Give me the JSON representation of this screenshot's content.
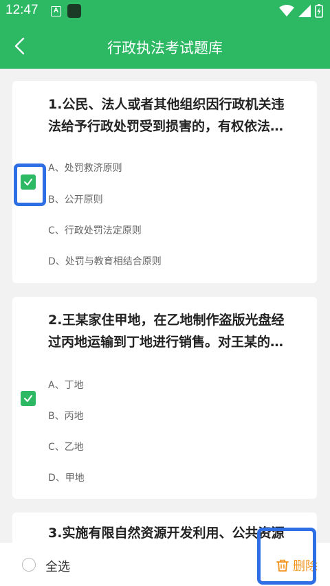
{
  "status_bar": {
    "time": "12:47",
    "notification_letter": "A"
  },
  "header": {
    "title": "行政执法考试题库"
  },
  "questions": [
    {
      "title_line1": "1.公民、法人或者其他组织因行政机关违",
      "title_line2": "法给予行政处罚受到损害的，有权依法…",
      "checked": true,
      "options": [
        "A、处罚救济原则",
        "B、公开原则",
        "C、行政处罚法定原则",
        "D、处罚与教育相结合原则"
      ]
    },
    {
      "title_line1": "2.王某家住甲地，在乙地制作盗版光盘经",
      "title_line2": "过丙地运输到丁地进行销售。对王某的…",
      "checked": true,
      "options": [
        "A、丁地",
        "B、丙地",
        "C、乙地",
        "D、甲地"
      ]
    },
    {
      "title_line1": "3.实施有限自然资源开发利用、公共资源"
    }
  ],
  "bottom_bar": {
    "select_all_label": "全选",
    "delete_label": "删除"
  },
  "colors": {
    "primary": "#2db964",
    "highlight": "#2f6fe6",
    "delete": "#f3921b"
  }
}
